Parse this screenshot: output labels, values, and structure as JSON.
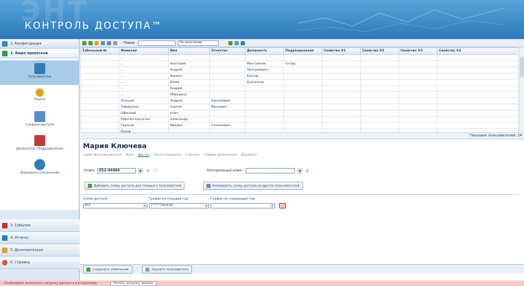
{
  "app": {
    "ghost_text": "ЭНТ",
    "title": "КОНТРОЛЬ ДОСТУПА™"
  },
  "colors": {
    "banner": "#3f8cc9",
    "sidebar": "#dfe9f3",
    "selected_item": "#a9cbe8",
    "footer": "#f3c9cc"
  },
  "sidebar": {
    "top_items": [
      {
        "label": "1. Конфигурация",
        "icon": "config-icon",
        "color": "#3c82c4"
      },
      {
        "label": "2. Бюро пропусков",
        "icon": "bureau-icon",
        "color": "#2f9a4a"
      }
    ],
    "sub_items": [
      {
        "label": "Пользователи",
        "icon": "users-icon",
        "color": "#2f7db4",
        "selected": true
      },
      {
        "label": "Ключи",
        "icon": "keys-icon",
        "color": "#e0a21c",
        "selected": false
      },
      {
        "label": "Графики доступа",
        "icon": "schedule-icon",
        "color": "#5a8fc7",
        "selected": false
      },
      {
        "label": "Должности / Подразделения",
        "icon": "departments-icon",
        "color": "#c03c3c",
        "selected": false
      },
      {
        "label": "Документы отклонений",
        "icon": "documents-icon",
        "color": "#2f7db4",
        "selected": false
      }
    ],
    "bottom_items": [
      {
        "label": "3. События",
        "icon": "events-icon",
        "color": "#c9302c"
      },
      {
        "label": "4. Отчеты",
        "icon": "reports-icon",
        "color": "#2f7db4"
      },
      {
        "label": "5. Дополнительно",
        "icon": "extra-icon",
        "color": "#e0a21c"
      },
      {
        "label": "6. Справка",
        "icon": "help-icon",
        "color": "#d9534f"
      }
    ]
  },
  "toolbar": {
    "search_label": "Поиск:",
    "search_value": "",
    "mode_value": "По окончании"
  },
  "grid": {
    "columns": [
      "Табельный №",
      "Фамилия",
      "Имя",
      "Отчество",
      "Должность",
      "Подразделение",
      "Свойство #1",
      "Свойство #2",
      "Свойство #3",
      "Свойство #4"
    ],
    "rows": [
      [
        "",
        "...",
        "",
        "",
        "",
        "",
        "",
        "",
        "",
        ""
      ],
      [
        "",
        "...",
        "Анатолий",
        "",
        "Монтажник",
        "Склад",
        "",
        "",
        "",
        ""
      ],
      [
        "",
        "...",
        "Андрей",
        "",
        "Программист",
        "",
        "",
        "",
        "",
        ""
      ],
      [
        "",
        "...",
        "Кирилл",
        "",
        "Кассир",
        "",
        "",
        "",
        "",
        ""
      ],
      [
        "",
        "...",
        "Юлия",
        "",
        "Бухгалтер",
        "",
        "",
        "",
        "",
        ""
      ],
      [
        "",
        "...",
        "Андрей",
        "",
        "",
        "",
        "",
        "",
        "",
        ""
      ],
      [
        "",
        "...",
        "Уборщица",
        "",
        "",
        "",
        "",
        "",
        "",
        ""
      ],
      [
        "",
        "Ананьев",
        "Андрей",
        "Николаевич",
        "",
        "",
        "",
        "",
        "",
        ""
      ],
      [
        "",
        "Тимирукин",
        "Сергей",
        "Иванович",
        "",
        "",
        "",
        "",
        "",
        ""
      ],
      [
        "",
        "Офисный",
        "ключ",
        "",
        "",
        "",
        "",
        "",
        "",
        ""
      ],
      [
        "",
        "Рабочая карточка",
        "Александр",
        "",
        "",
        "",
        "",
        "",
        "",
        ""
      ],
      [
        "",
        "Тарасов",
        "Михаил",
        "Степанович",
        "",
        "",
        "",
        "",
        "",
        ""
      ],
      [
        "",
        "Попов",
        "",
        "",
        "",
        "",
        "",
        "",
        "",
        ""
      ]
    ],
    "count_text": "Показано пользователей: 24"
  },
  "detail": {
    "person_name": "Мария Ключева",
    "tabs": [
      "Свойства пользователя",
      "Фото",
      "Доступ",
      "Печать пропуска",
      "События",
      "График дополнений",
      "Документ"
    ],
    "key_label": "Ключ:",
    "key_value": "012-44444",
    "control_key_label": "Контрольный ключ:",
    "control_key_value": "",
    "add_scheme_btn": "Добавить схему доступа для текущего пользователя",
    "copy_scheme_btn": "Копировать схему доступа на других пользователей",
    "scheme_label": "Схема доступа:",
    "scheme_value": "Все",
    "current_schedule_label": "График на текущий год:",
    "current_schedule_value": "[*****] всегда",
    "next_schedule_label": "График на следующий год:",
    "next_schedule_value": ""
  },
  "bottom": {
    "save_btn": "Сохранить изменения",
    "delete_btn": "Удалить пользователя"
  },
  "footer": {
    "message": "Необходимо выполнить загрузку данных в контроллеры",
    "load_btn": "Начать загрузку данных"
  }
}
